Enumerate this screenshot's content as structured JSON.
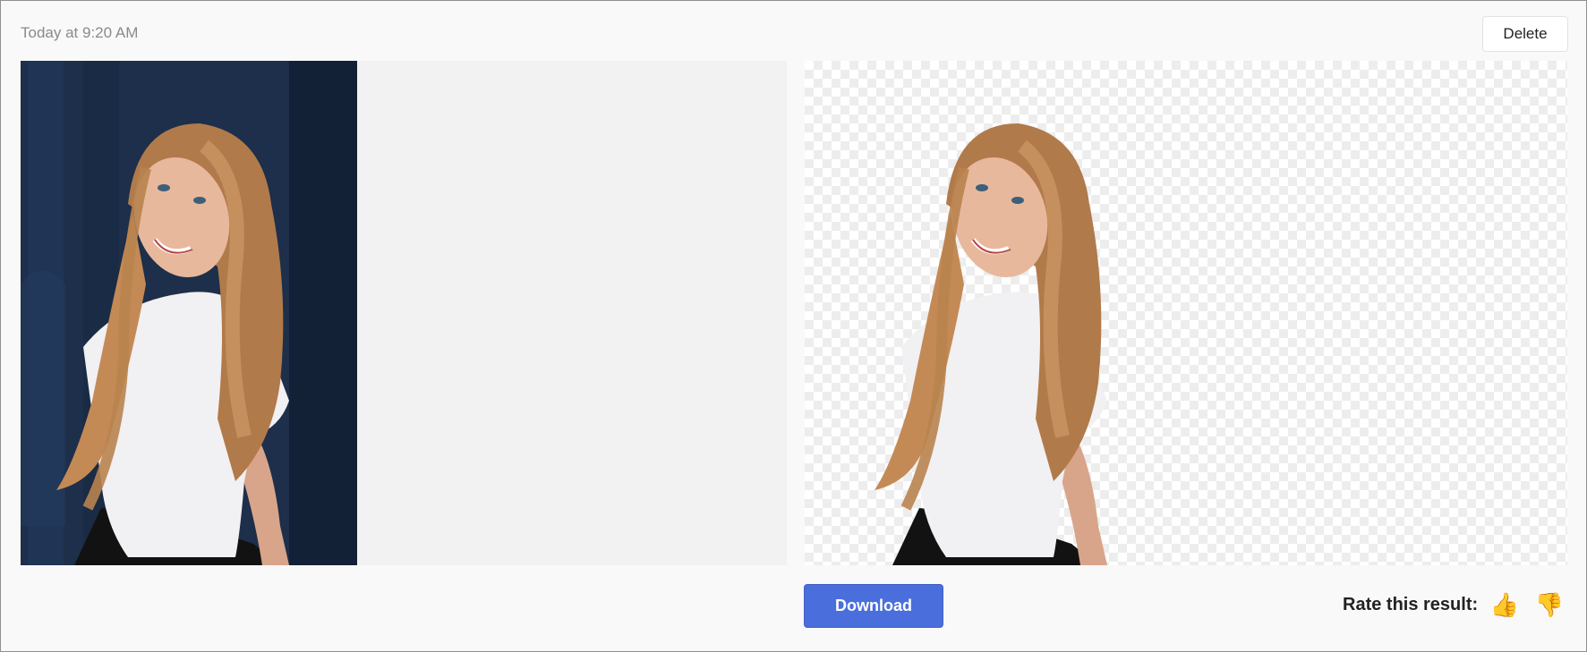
{
  "header": {
    "timestamp": "Today at 9:20 AM",
    "delete_label": "Delete"
  },
  "images": {
    "original": {
      "alt": "Original photo: smiling woman with long hair in white t-shirt against dark blue wall"
    },
    "result": {
      "alt": "Background removed result on transparent checkerboard"
    }
  },
  "actions": {
    "download_label": "Download",
    "rate_label": "Rate this result:",
    "thumbs_up": "👍",
    "thumbs_down": "👎"
  },
  "colors": {
    "accent": "#4a6fdc",
    "thumb": "#f2b203"
  }
}
